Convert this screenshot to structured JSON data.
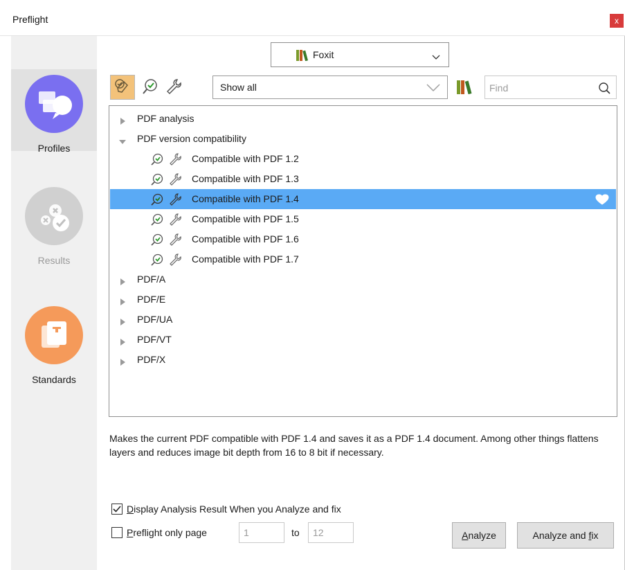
{
  "window": {
    "title": "Preflight",
    "close_label": "x"
  },
  "sidebar": {
    "items": [
      {
        "label": "Profiles",
        "icon": "profiles-icon",
        "color": "#7a6ff0",
        "active": true
      },
      {
        "label": "Results",
        "icon": "results-icon",
        "color": "#d0d0d0",
        "active": false
      },
      {
        "label": "Standards",
        "icon": "standards-icon",
        "color": "#f59a5a",
        "active": false
      }
    ]
  },
  "profile_library": {
    "selected": "Foxit"
  },
  "toolbar": {
    "filter_selected": "Show all",
    "find_placeholder": "Find"
  },
  "tree": {
    "groups": [
      {
        "label": "PDF analysis",
        "expanded": false
      },
      {
        "label": "PDF version compatibility",
        "expanded": true,
        "children": [
          "Compatible with PDF 1.2",
          "Compatible with PDF 1.3",
          "Compatible with PDF 1.4",
          "Compatible with PDF 1.5",
          "Compatible with PDF 1.6",
          "Compatible with PDF 1.7"
        ],
        "selected_child": "Compatible with PDF 1.4"
      },
      {
        "label": "PDF/A",
        "expanded": false
      },
      {
        "label": "PDF/E",
        "expanded": false
      },
      {
        "label": "PDF/UA",
        "expanded": false
      },
      {
        "label": "PDF/VT",
        "expanded": false
      },
      {
        "label": "PDF/X",
        "expanded": false
      }
    ]
  },
  "description": "Makes the current PDF compatible with PDF 1.4 and saves it as a PDF 1.4 document. Among other things flattens layers and reduces image bit depth from 16 to 8 bit if necessary.",
  "options": {
    "display_result": {
      "prefix": "D",
      "rest": "isplay Analysis Result When you Analyze and fix",
      "checked": true
    },
    "only_page": {
      "prefix": "P",
      "rest": "reflight only page",
      "checked": false,
      "from": "1",
      "to_label": "to",
      "to": "12"
    }
  },
  "buttons": {
    "analyze": {
      "prefix": "A",
      "rest": "nalyze"
    },
    "analyze_fix": {
      "pre": "Analyze and ",
      "u": "f",
      "post": "ix"
    }
  },
  "colors": {
    "selection": "#5aaaf5",
    "accent_green": "#3a9a3a"
  }
}
